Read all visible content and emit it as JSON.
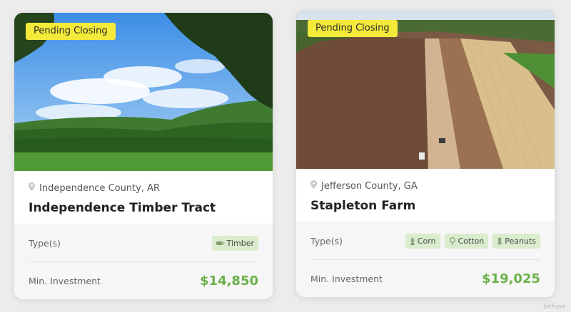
{
  "listings": [
    {
      "badge": "Pending Closing",
      "location": "Independence County, AR",
      "title": "Independence Timber Tract",
      "type_label": "Type(s)",
      "types": [
        {
          "label": "Timber",
          "icon": "timber-icon"
        }
      ],
      "investment_label": "Min. Investment",
      "min_investment": "$14,850"
    },
    {
      "badge": "Pending Closing",
      "location": "Jefferson County, GA",
      "title": "Stapleton Farm",
      "type_label": "Type(s)",
      "types": [
        {
          "label": "Corn",
          "icon": "corn-icon"
        },
        {
          "label": "Cotton",
          "icon": "cotton-icon"
        },
        {
          "label": "Peanuts",
          "icon": "peanut-icon"
        }
      ],
      "investment_label": "Min. Investment",
      "min_investment": "$19,025"
    }
  ],
  "watermark": "bitfuse",
  "colors": {
    "badge": "#f4ea3a",
    "price": "#6bb14a",
    "chip": "#d9eccd"
  }
}
